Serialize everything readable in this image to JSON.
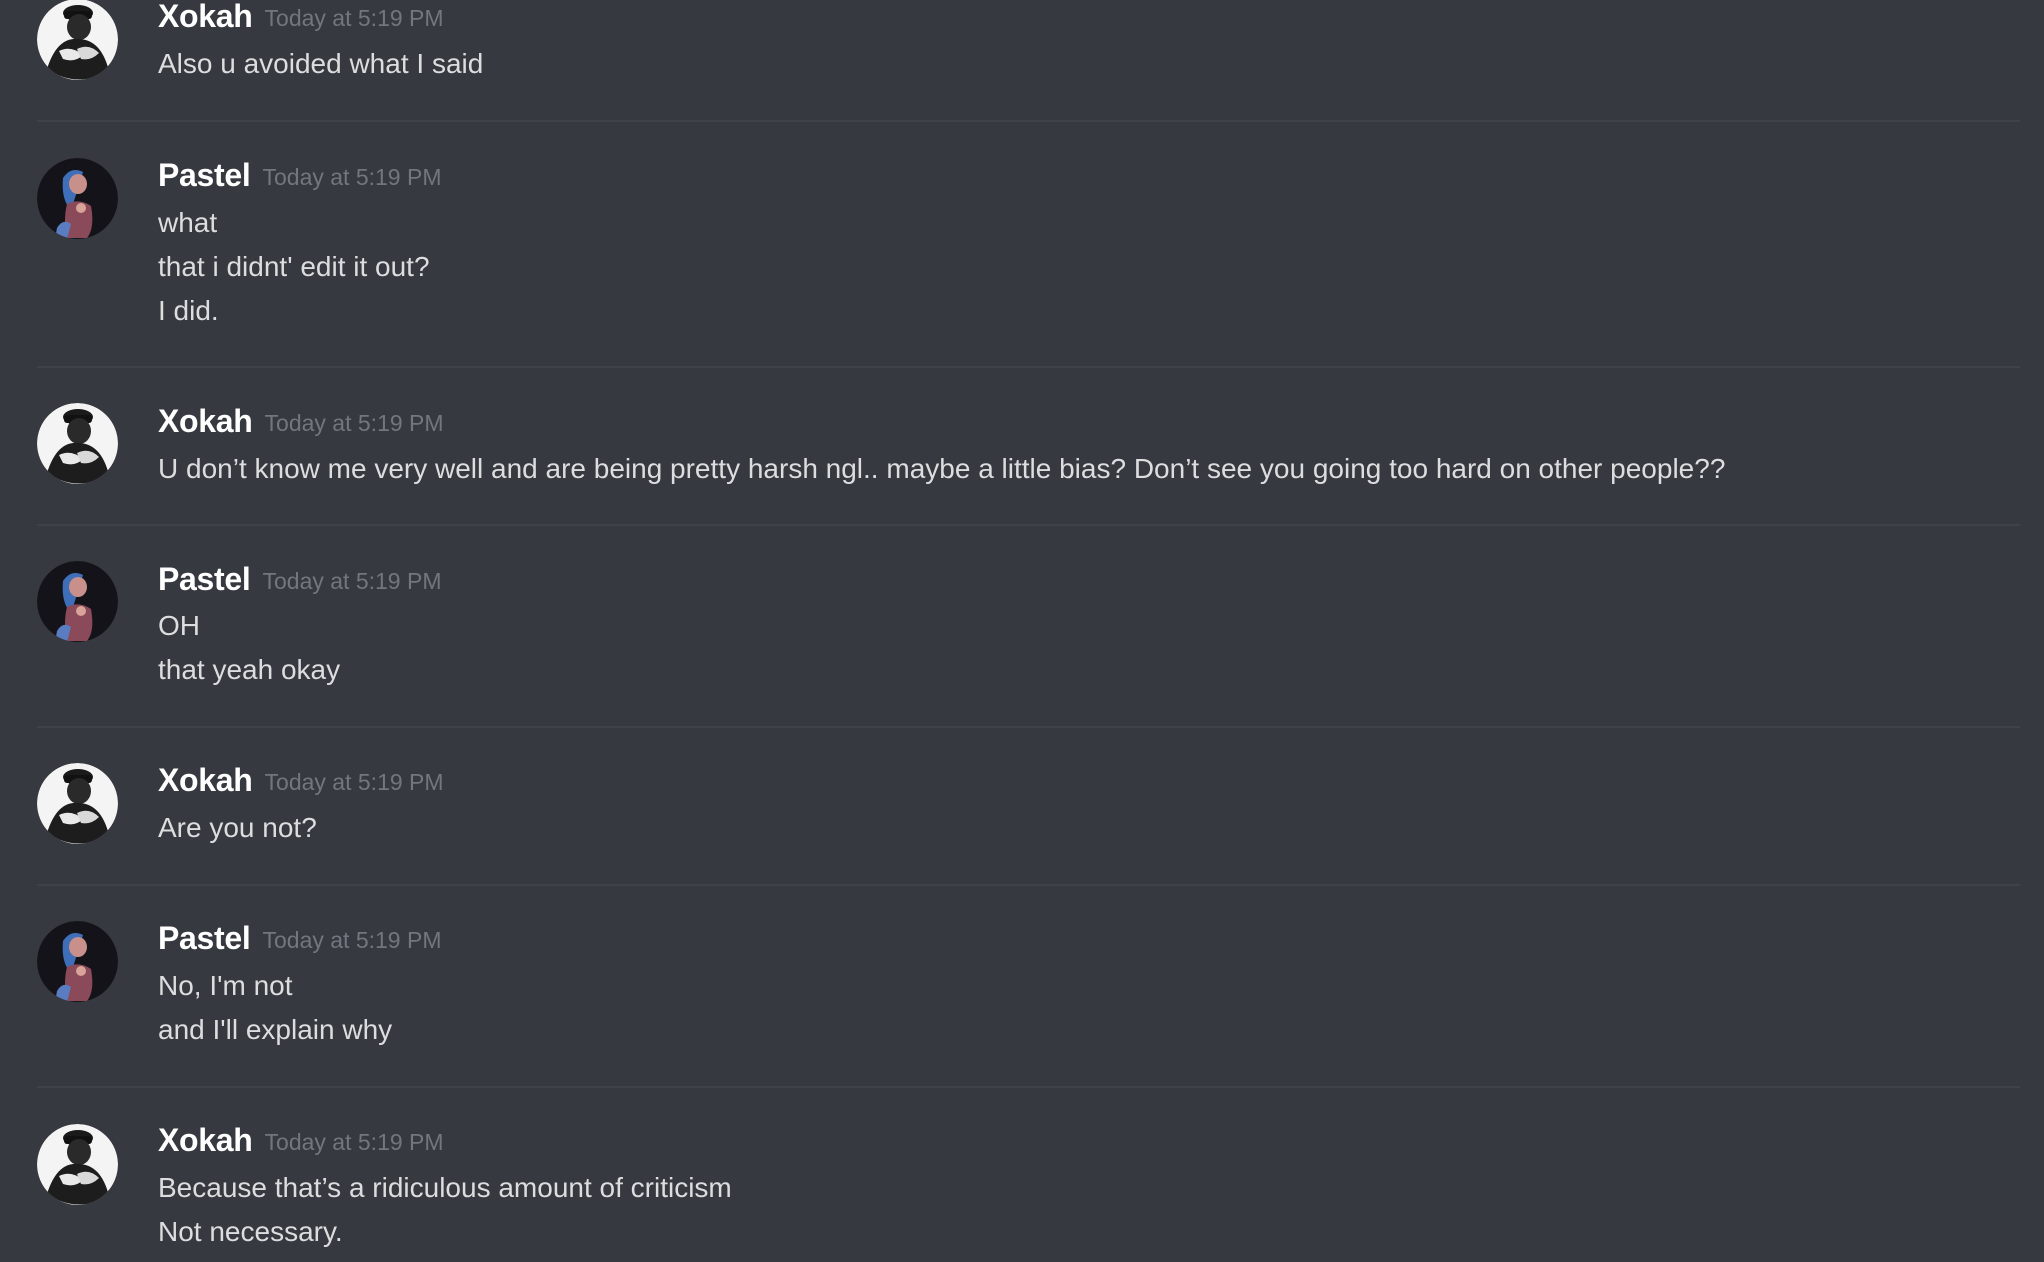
{
  "messages": [
    {
      "author": "Xokah",
      "timestamp": "Today at 5:19 PM",
      "lines": [
        "Also u avoided what I said"
      ]
    },
    {
      "author": "Pastel",
      "timestamp": "Today at 5:19 PM",
      "lines": [
        "what",
        "that i didnt' edit it out?",
        "I did."
      ]
    },
    {
      "author": "Xokah",
      "timestamp": "Today at 5:19 PM",
      "lines": [
        "U don’t know me very well and are being pretty harsh ngl.. maybe a little bias? Don’t see you going too hard on other people??"
      ]
    },
    {
      "author": "Pastel",
      "timestamp": "Today at 5:19 PM",
      "lines": [
        "OH",
        "that yeah okay"
      ]
    },
    {
      "author": "Xokah",
      "timestamp": "Today at 5:19 PM",
      "lines": [
        "Are you not?"
      ]
    },
    {
      "author": "Pastel",
      "timestamp": "Today at 5:19 PM",
      "lines": [
        "No, I'm not",
        "and I'll explain why"
      ]
    },
    {
      "author": "Xokah",
      "timestamp": "Today at 5:19 PM",
      "lines": [
        "Because that’s a ridiculous amount of criticism",
        "Not necessary."
      ]
    }
  ],
  "colors": {
    "background": "#36393f",
    "username": "#ffffff",
    "message_text": "#dcddde",
    "timestamp": "#72767d",
    "divider": "#3f4248"
  },
  "icons": {
    "xokah_avatar": "user-avatar-icon",
    "pastel_avatar": "user-avatar-icon"
  }
}
